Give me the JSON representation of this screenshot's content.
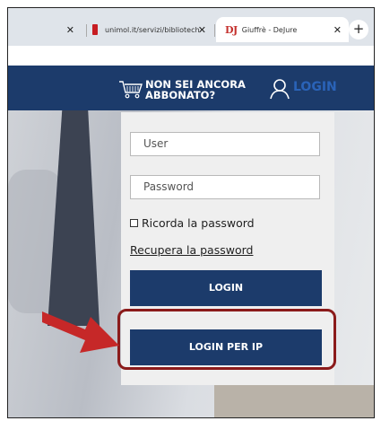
{
  "browser": {
    "tabs": [
      {
        "title": "",
        "active": false
      },
      {
        "title": "unimol.it/servizi/biblioteche/bi",
        "active": false
      },
      {
        "title": "Giuffrè - DeJure",
        "active": true
      }
    ],
    "tab_favicon_dj": "DJ",
    "close_glyph": "✕",
    "new_tab_glyph": "+"
  },
  "header": {
    "subscribe_line1": "NON SEI ANCORA",
    "subscribe_line2": "ABBONATO?",
    "login_link": "LOGIN",
    "cart_icon": "cart-icon",
    "user_icon": "user-icon"
  },
  "login_form": {
    "user_placeholder": "User",
    "password_placeholder": "Password",
    "remember_label": "Ricorda la password",
    "remember_checked": false,
    "recover_link": "Recupera la password",
    "login_button": "LOGIN",
    "login_ip_button": "LOGIN PER IP"
  },
  "colors": {
    "navy": "#1c3b6b",
    "annotation_red": "#8b1b1b",
    "arrow_red": "#c62828"
  }
}
